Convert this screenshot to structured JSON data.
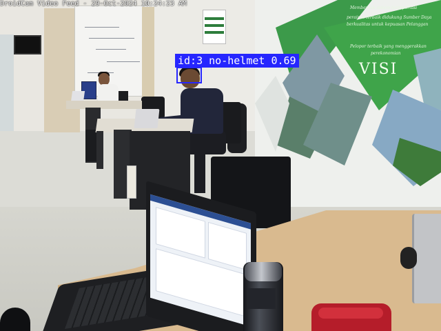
{
  "window": {
    "title": "DroidCam Video Feed - 29-Oct-2024 10:24:23 AM"
  },
  "detections": [
    {
      "id_text": "id:3",
      "class": "no-helmet",
      "confidence": "0.69",
      "label": "id:3 no-helmet 0.69",
      "box_color": "#2626ff"
    }
  ],
  "mural": {
    "heading": "VISI",
    "lines": [
      "Membentuk sistem transportasi",
      "perairan terbaik didukung Sumber Daya",
      "berkualitas untuk kepuasan Pelanggan",
      "Pelopor terbaik yang menggerakkan",
      "perekonomian"
    ],
    "accent_color": "#3fa44a"
  },
  "colors": {
    "caption_text": "#ffffff",
    "detection_box": "#2626ff",
    "detection_label_text": "#ffffff"
  }
}
